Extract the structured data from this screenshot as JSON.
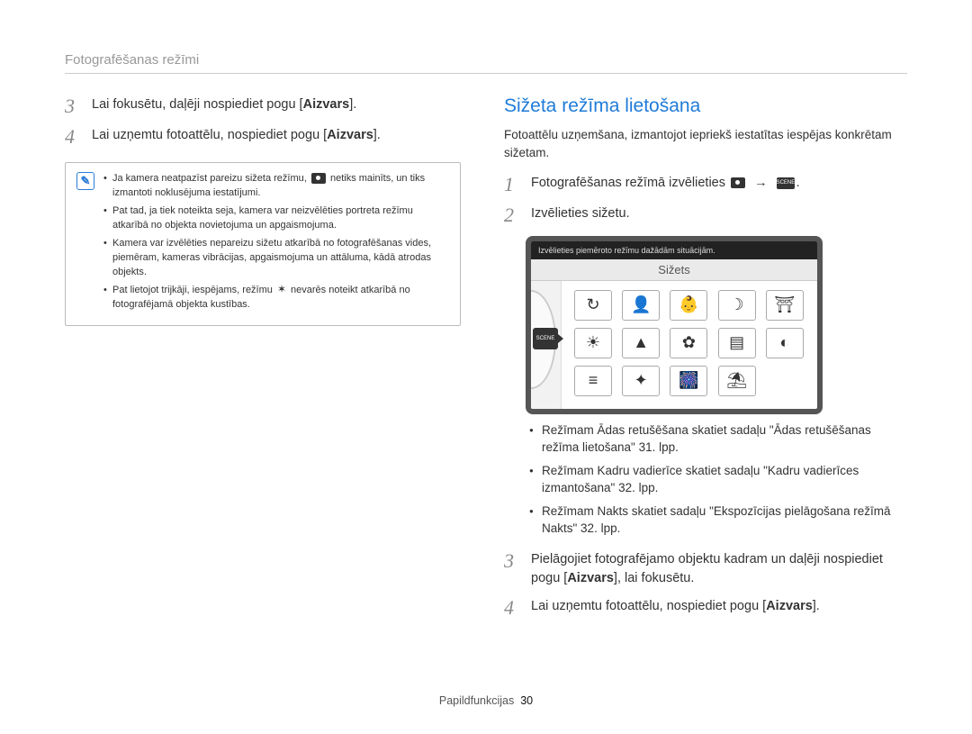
{
  "breadcrumb": "Fotografēšanas režīmi",
  "left": {
    "steps": [
      {
        "num": "3",
        "text_before": "Lai fokusētu, daļēji nospiediet pogu [",
        "bold": "Aizvars",
        "text_after": "]."
      },
      {
        "num": "4",
        "text_before": "Lai uzņemtu fotoattēlu, nospiediet pogu [",
        "bold": "Aizvars",
        "text_after": "]."
      }
    ],
    "notes": [
      "Ja kamera neatpazīst pareizu sižeta režīmu, [icon] netiks mainīts, un tiks izmantoti noklusējuma iestatījumi.",
      "Pat tad, ja tiek noteikta seja, kamera var neizvēlēties portreta režīmu atkarībā no objekta novietojuma un apgaismojuma.",
      "Kamera var izvēlēties nepareizu sižetu atkarībā no fotografēšanas vides, piemēram, kameras vibrācijas, apgaismojuma un attāluma, kādā atrodas objekts.",
      "Pat lietojot trijkāji, iespējams, režīmu [icon] nevarēs noteikt atkarībā no fotografējamā objekta kustības."
    ]
  },
  "right": {
    "heading": "Sižeta režīma lietošana",
    "intro": "Fotoattēlu uzņemšana, izmantojot iepriekš iestatītas iespējas konkrētam sižetam.",
    "steps_top": [
      {
        "num": "1",
        "text": "Fotografēšanas režīmā izvēlieties"
      },
      {
        "num": "2",
        "text": "Izvēlieties sižetu."
      }
    ],
    "screen": {
      "hint": "Izvēlieties piemēroto režīmu dažādām situācijām.",
      "title": "Sižets",
      "scene_label": "SCENE",
      "icons": [
        "↻",
        "👤",
        "👶",
        "☽",
        "⛩",
        "☀",
        "▲",
        "✿",
        "▤",
        "◐",
        "≡",
        "✦",
        "🎆",
        "⛱"
      ]
    },
    "bullets": [
      "Režīmam Ādas retušēšana skatiet sadaļu \"Ādas retušēšanas režīma lietošana\" 31. lpp.",
      "Režīmam Kadru vadierīce skatiet sadaļu \"Kadru vadierīces izmantošana\" 32. lpp.",
      "Režīmam Nakts skatiet sadaļu \"Ekspozīcijas pielāgošana režīmā Nakts\" 32. lpp."
    ],
    "steps_bottom": [
      {
        "num": "3",
        "text_before": "Pielāgojiet fotografējamo objektu kadram un daļēji nospiediet pogu [",
        "bold": "Aizvars",
        "text_after": "], lai fokusētu."
      },
      {
        "num": "4",
        "text_before": "Lai uzņemtu fotoattēlu, nospiediet pogu [",
        "bold": "Aizvars",
        "text_after": "]."
      }
    ]
  },
  "footer": {
    "label": "Papildfunkcijas",
    "page": "30"
  }
}
